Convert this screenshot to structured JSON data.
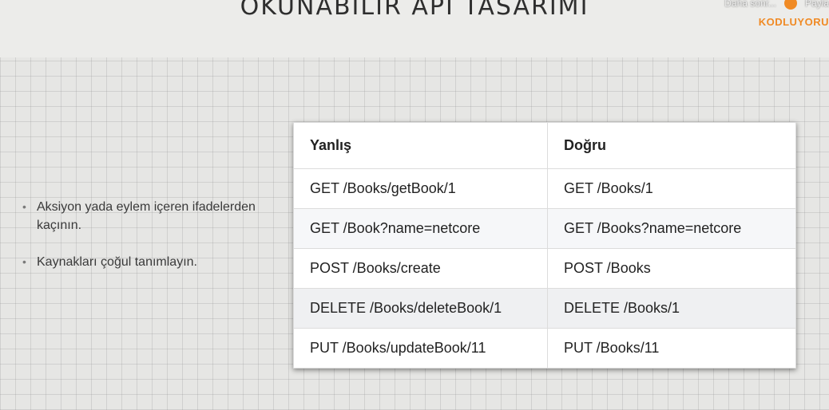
{
  "slide": {
    "title": "OKUNABİLİR API TASARIMI"
  },
  "overlay": {
    "later_text": "Daha sonr...",
    "share_text": "Payla",
    "brand": "KODLUYORU"
  },
  "bullets": [
    "Aksiyon yada eylem içeren ifadelerden kaçının.",
    "Kaynakları çoğul tanımlayın."
  ],
  "table": {
    "headers": [
      "Yanlış",
      "Doğru"
    ],
    "rows": [
      [
        "GET /Books/getBook/1",
        "GET /Books/1"
      ],
      [
        "GET /Book?name=netcore",
        "GET /Books?name=netcore"
      ],
      [
        "POST /Books/create",
        "POST /Books"
      ],
      [
        "DELETE /Books/deleteBook/1",
        "DELETE /Books/1"
      ],
      [
        "PUT /Books/updateBook/11",
        "PUT /Books/11"
      ]
    ]
  },
  "colors": {
    "brand": "#f08a24",
    "title": "#2e2e2e"
  }
}
